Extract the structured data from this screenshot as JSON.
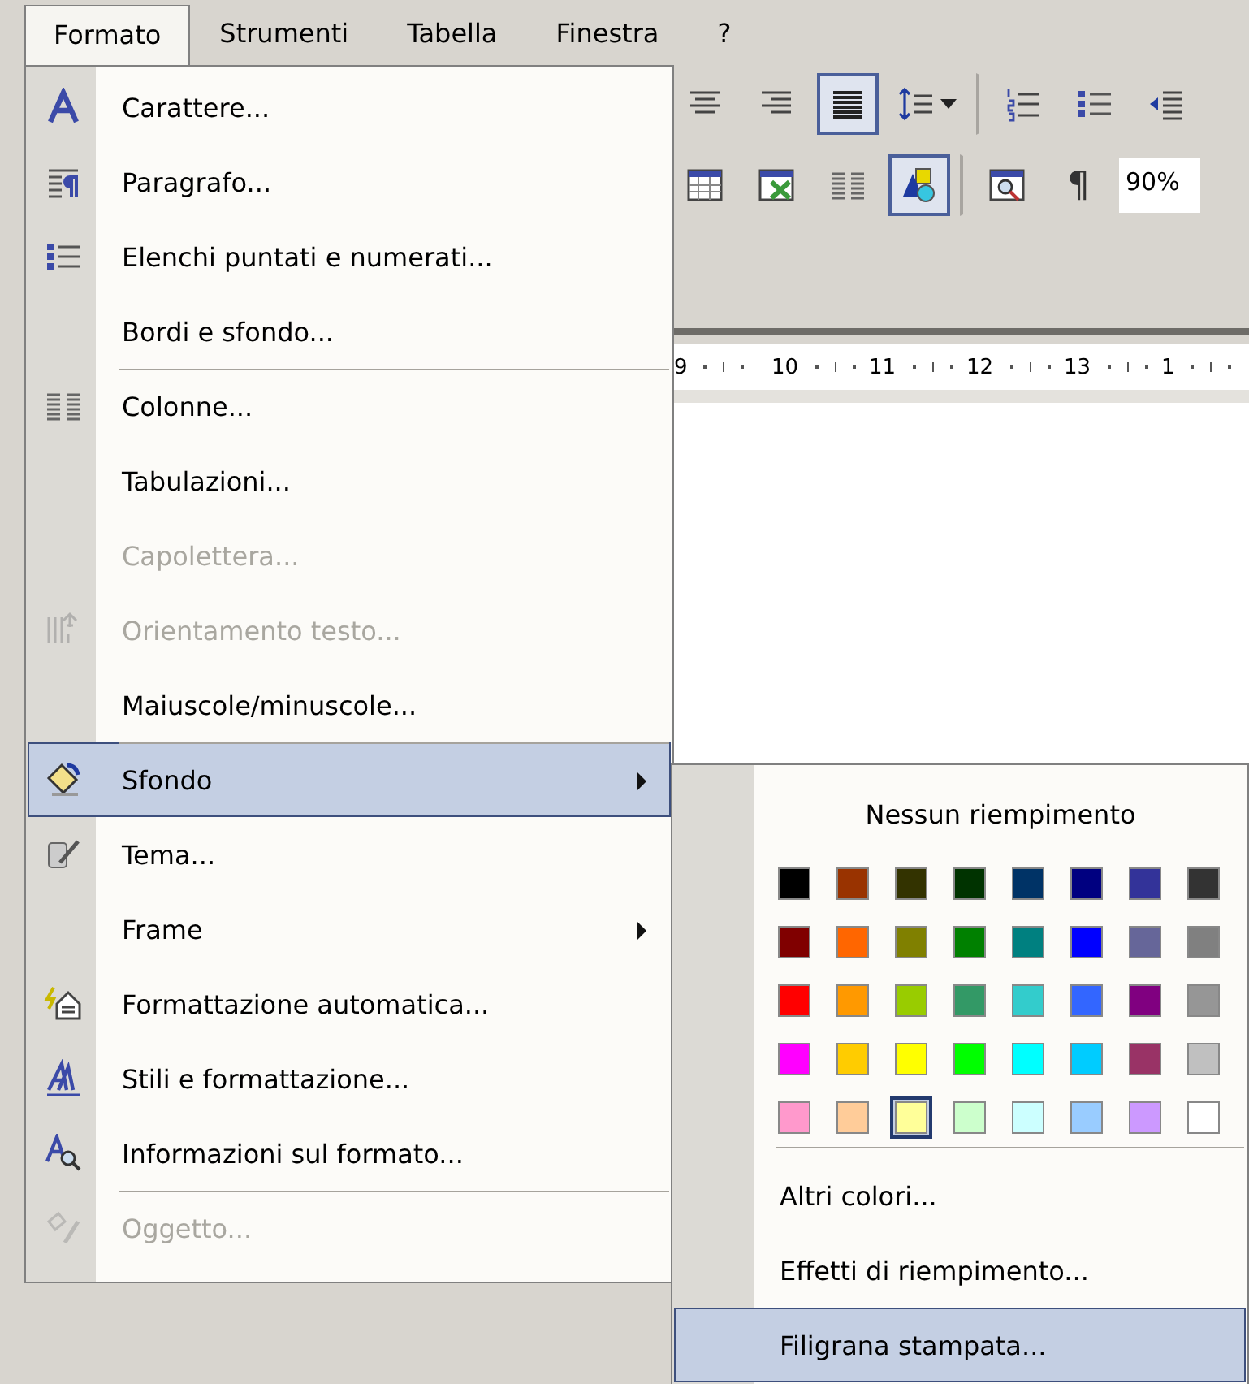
{
  "menubar": {
    "items": [
      {
        "label": "Formato",
        "selected": true
      },
      {
        "label": "Strumenti",
        "selected": false
      },
      {
        "label": "Tabella",
        "selected": false
      },
      {
        "label": "Finestra",
        "selected": false
      },
      {
        "label": "?",
        "selected": false
      }
    ]
  },
  "toolbars": [
    {
      "items": [
        {
          "kind": "button",
          "pressed": false,
          "separator_before": false
        },
        {
          "kind": "button",
          "pressed": false,
          "separator_before": false
        },
        {
          "kind": "button",
          "pressed": true,
          "separator_before": false
        },
        {
          "kind": "dropdown",
          "pressed": false,
          "separator_before": false
        },
        {
          "kind": "button",
          "pressed": false,
          "separator_before": true
        },
        {
          "kind": "button",
          "pressed": false,
          "separator_before": false
        },
        {
          "kind": "button",
          "pressed": false,
          "separator_before": false
        }
      ]
    },
    {
      "items": [
        {
          "kind": "button",
          "pressed": false,
          "separator_before": false
        },
        {
          "kind": "button",
          "pressed": false,
          "separator_before": false
        },
        {
          "kind": "button",
          "pressed": false,
          "separator_before": false
        },
        {
          "kind": "button",
          "pressed": true,
          "separator_before": false
        },
        {
          "kind": "button",
          "pressed": false,
          "separator_before": true
        },
        {
          "kind": "text-button",
          "label": "¶",
          "pressed": false,
          "separator_before": false
        },
        {
          "kind": "field",
          "value": "90%",
          "separator_before": false
        }
      ]
    }
  ],
  "ruler": {
    "labels": [
      "9",
      "10",
      "11",
      "12",
      "13",
      "1"
    ]
  },
  "menu": {
    "items": [
      {
        "label": "Carattere...",
        "disabled": false,
        "selected": false,
        "submenu": false,
        "separator_before": false
      },
      {
        "label": "Paragrafo...",
        "disabled": false,
        "selected": false,
        "submenu": false,
        "separator_before": false
      },
      {
        "label": "Elenchi puntati e numerati...",
        "disabled": false,
        "selected": false,
        "submenu": false,
        "separator_before": false
      },
      {
        "label": "Bordi e sfondo...",
        "disabled": false,
        "selected": false,
        "submenu": false,
        "separator_before": false
      },
      {
        "label": "Colonne...",
        "disabled": false,
        "selected": false,
        "submenu": false,
        "separator_before": true
      },
      {
        "label": "Tabulazioni...",
        "disabled": false,
        "selected": false,
        "submenu": false,
        "separator_before": false
      },
      {
        "label": "Capolettera...",
        "disabled": true,
        "selected": false,
        "submenu": false,
        "separator_before": false
      },
      {
        "label": "Orientamento testo...",
        "disabled": true,
        "selected": false,
        "submenu": false,
        "separator_before": false
      },
      {
        "label": "Maiuscole/minuscole...",
        "disabled": false,
        "selected": false,
        "submenu": false,
        "separator_before": false
      },
      {
        "label": "Sfondo",
        "disabled": false,
        "selected": true,
        "submenu": true,
        "separator_before": true
      },
      {
        "label": "Tema...",
        "disabled": false,
        "selected": false,
        "submenu": false,
        "separator_before": false
      },
      {
        "label": "Frame",
        "disabled": false,
        "selected": false,
        "submenu": true,
        "separator_before": false
      },
      {
        "label": "Formattazione automatica...",
        "disabled": false,
        "selected": false,
        "submenu": false,
        "separator_before": false
      },
      {
        "label": "Stili e formattazione...",
        "disabled": false,
        "selected": false,
        "submenu": false,
        "separator_before": false
      },
      {
        "label": "Informazioni sul formato...",
        "disabled": false,
        "selected": false,
        "submenu": false,
        "separator_before": false
      },
      {
        "label": "Oggetto...",
        "disabled": true,
        "selected": false,
        "submenu": false,
        "separator_before": true
      }
    ]
  },
  "submenu": {
    "no_fill": {
      "label": "Nessun riempimento"
    },
    "palette": [
      {
        "swatches": [
          {
            "color": "#000000",
            "selected": false
          },
          {
            "color": "#993300",
            "selected": false
          },
          {
            "color": "#333300",
            "selected": false
          },
          {
            "color": "#003300",
            "selected": false
          },
          {
            "color": "#003366",
            "selected": false
          },
          {
            "color": "#000080",
            "selected": false
          },
          {
            "color": "#333399",
            "selected": false
          },
          {
            "color": "#333333",
            "selected": false
          }
        ]
      },
      {
        "swatches": [
          {
            "color": "#800000",
            "selected": false
          },
          {
            "color": "#ff6600",
            "selected": false
          },
          {
            "color": "#808000",
            "selected": false
          },
          {
            "color": "#008000",
            "selected": false
          },
          {
            "color": "#008080",
            "selected": false
          },
          {
            "color": "#0000ff",
            "selected": false
          },
          {
            "color": "#666699",
            "selected": false
          },
          {
            "color": "#808080",
            "selected": false
          }
        ]
      },
      {
        "swatches": [
          {
            "color": "#ff0000",
            "selected": false
          },
          {
            "color": "#ff9900",
            "selected": false
          },
          {
            "color": "#99cc00",
            "selected": false
          },
          {
            "color": "#339966",
            "selected": false
          },
          {
            "color": "#33cccc",
            "selected": false
          },
          {
            "color": "#3366ff",
            "selected": false
          },
          {
            "color": "#800080",
            "selected": false
          },
          {
            "color": "#969696",
            "selected": false
          }
        ]
      },
      {
        "swatches": [
          {
            "color": "#ff00ff",
            "selected": false
          },
          {
            "color": "#ffcc00",
            "selected": false
          },
          {
            "color": "#ffff00",
            "selected": false
          },
          {
            "color": "#00ff00",
            "selected": false
          },
          {
            "color": "#00ffff",
            "selected": false
          },
          {
            "color": "#00ccff",
            "selected": false
          },
          {
            "color": "#993366",
            "selected": false
          },
          {
            "color": "#c0c0c0",
            "selected": false
          }
        ]
      },
      {
        "swatches": [
          {
            "color": "#ff99cc",
            "selected": false
          },
          {
            "color": "#ffcc99",
            "selected": false
          },
          {
            "color": "#ffff99",
            "selected": true
          },
          {
            "color": "#ccffcc",
            "selected": false
          },
          {
            "color": "#ccffff",
            "selected": false
          },
          {
            "color": "#99ccff",
            "selected": false
          },
          {
            "color": "#cc99ff",
            "selected": false
          },
          {
            "color": "#ffffff",
            "selected": false
          }
        ]
      }
    ],
    "items": [
      {
        "label": "Altri colori...",
        "selected": false,
        "separator_before": true
      },
      {
        "label": "Effetti di riempimento...",
        "selected": false,
        "separator_before": false
      },
      {
        "label": "Filigrana stampata...",
        "selected": true,
        "separator_before": false
      }
    ]
  }
}
